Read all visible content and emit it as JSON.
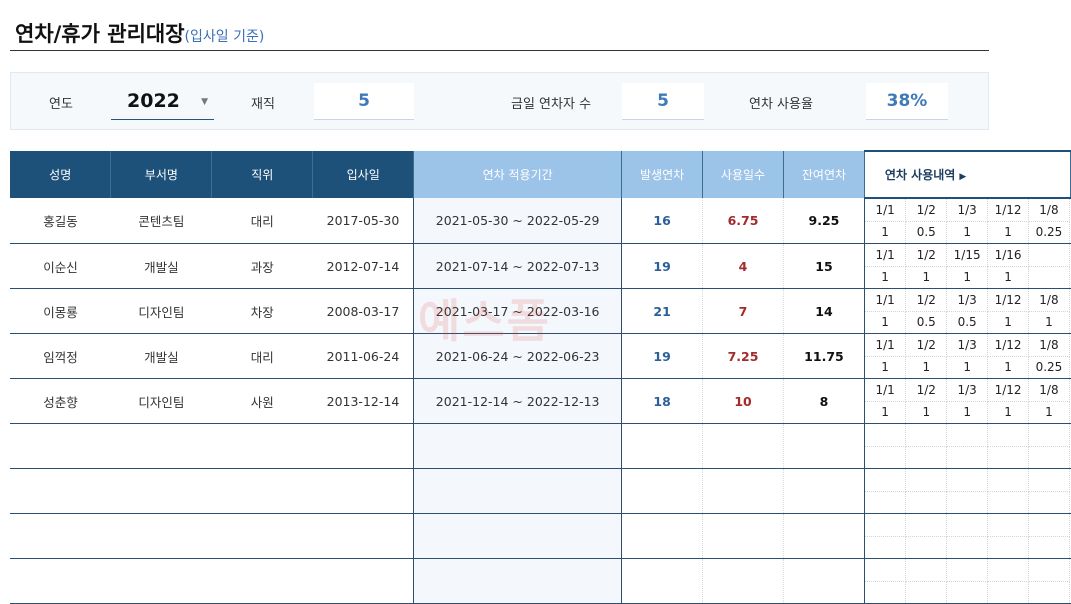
{
  "title": {
    "main": "연차/휴가 관리대장",
    "sub": "(입사일 기준)"
  },
  "info": {
    "year_label": "연도",
    "year_value": "2022",
    "employed_label": "재직",
    "employed_value": "5",
    "today_label": "금일 연차자 수",
    "today_value": "5",
    "usage_label": "연차 사용율",
    "usage_value": "38%"
  },
  "table": {
    "headers": [
      "성명",
      "부서명",
      "직위",
      "입사일",
      "연차 적용기간",
      "발생연차",
      "사용일수",
      "잔여연차",
      "연차 사용내역"
    ],
    "rows": [
      {
        "name": "홍길동",
        "dept": "콘텐츠팀",
        "pos": "대리",
        "hire": "2017-05-30",
        "period": "2021-05-30 ~ 2022-05-29",
        "gen": "16",
        "used": "6.75",
        "rem": "9.25",
        "dates": [
          "1/1",
          "1/2",
          "1/3",
          "1/12",
          "1/8"
        ],
        "days": [
          "1",
          "0.5",
          "1",
          "1",
          "0.25"
        ]
      },
      {
        "name": "이순신",
        "dept": "개발실",
        "pos": "과장",
        "hire": "2012-07-14",
        "period": "2021-07-14 ~ 2022-07-13",
        "gen": "19",
        "used": "4",
        "rem": "15",
        "dates": [
          "1/1",
          "1/2",
          "1/15",
          "1/16",
          ""
        ],
        "days": [
          "1",
          "1",
          "1",
          "1",
          ""
        ]
      },
      {
        "name": "이몽룡",
        "dept": "디자인팀",
        "pos": "차장",
        "hire": "2008-03-17",
        "period": "2021-03-17 ~ 2022-03-16",
        "gen": "21",
        "used": "7",
        "rem": "14",
        "dates": [
          "1/1",
          "1/2",
          "1/3",
          "1/12",
          "1/8"
        ],
        "days": [
          "1",
          "0.5",
          "0.5",
          "1",
          "1"
        ]
      },
      {
        "name": "임꺽정",
        "dept": "개발실",
        "pos": "대리",
        "hire": "2011-06-24",
        "period": "2021-06-24 ~ 2022-06-23",
        "gen": "19",
        "used": "7.25",
        "rem": "11.75",
        "dates": [
          "1/1",
          "1/2",
          "1/3",
          "1/12",
          "1/8"
        ],
        "days": [
          "1",
          "1",
          "1",
          "1",
          "0.25"
        ]
      },
      {
        "name": "성춘향",
        "dept": "디자인팀",
        "pos": "사원",
        "hire": "2013-12-14",
        "period": "2021-12-14 ~ 2022-12-13",
        "gen": "18",
        "used": "10",
        "rem": "8",
        "dates": [
          "1/1",
          "1/2",
          "1/3",
          "1/12",
          "1/8"
        ],
        "days": [
          "1",
          "1",
          "1",
          "1",
          "1"
        ]
      }
    ],
    "empty_rows": 4
  },
  "watermark": {
    "a": "예스",
    "b": "폼"
  }
}
